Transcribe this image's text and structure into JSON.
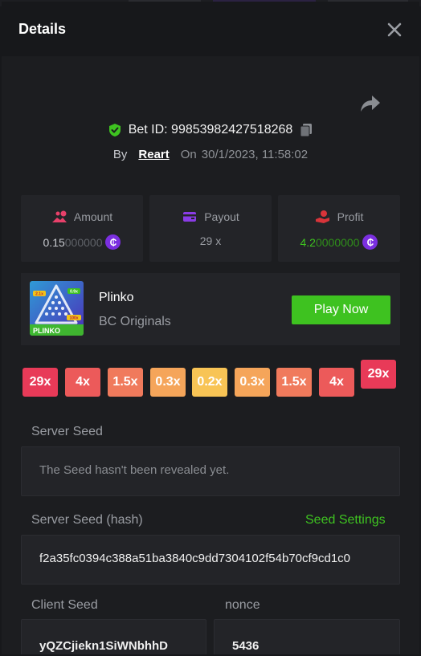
{
  "header": {
    "title": "Details"
  },
  "bet": {
    "id_label": "Bet ID: 99853982427518268",
    "by_label": "By",
    "user": "Reart",
    "on_label": "On",
    "datetime": "30/1/2023, 11:58:02"
  },
  "stats": {
    "amount": {
      "label": "Amount",
      "value_main": "0.15",
      "value_tail": "000000"
    },
    "payout": {
      "label": "Payout",
      "value": "29 x"
    },
    "profit": {
      "label": "Profit",
      "value_main": "4.2",
      "value_tail": "0000000"
    }
  },
  "coin_symbol": "₵",
  "game": {
    "name": "Plinko",
    "provider": "BC Originals",
    "play_label": "Play Now",
    "thumb_text": "PLINKO",
    "thumb_chips": [
      "2.1x",
      "0.9x",
      "100x"
    ]
  },
  "multipliers": [
    "29x",
    "4x",
    "1.5x",
    "0.3x",
    "0.2x",
    "0.3x",
    "1.5x",
    "4x",
    "29x"
  ],
  "seeds": {
    "server_seed_label": "Server Seed",
    "server_seed_value": "The Seed hasn't been revealed yet.",
    "server_hash_label": "Server Seed (hash)",
    "seed_settings_label": "Seed Settings",
    "server_hash_value": "f2a35fc0394c388a51ba3840c9dd7304102f54b70cf9cd1c0",
    "client_seed_label": "Client Seed",
    "client_seed_value": "yQZCjiekn1SiWNbhhD",
    "nonce_label": "nonce",
    "nonce_value": "5436"
  },
  "colors": {
    "accent_green": "#3ec220",
    "coin_purple": "#7b2fe0",
    "amount_icon": "#e8406a",
    "payout_icon": "#8a3ce6",
    "profit_icon": "#d8343a"
  }
}
